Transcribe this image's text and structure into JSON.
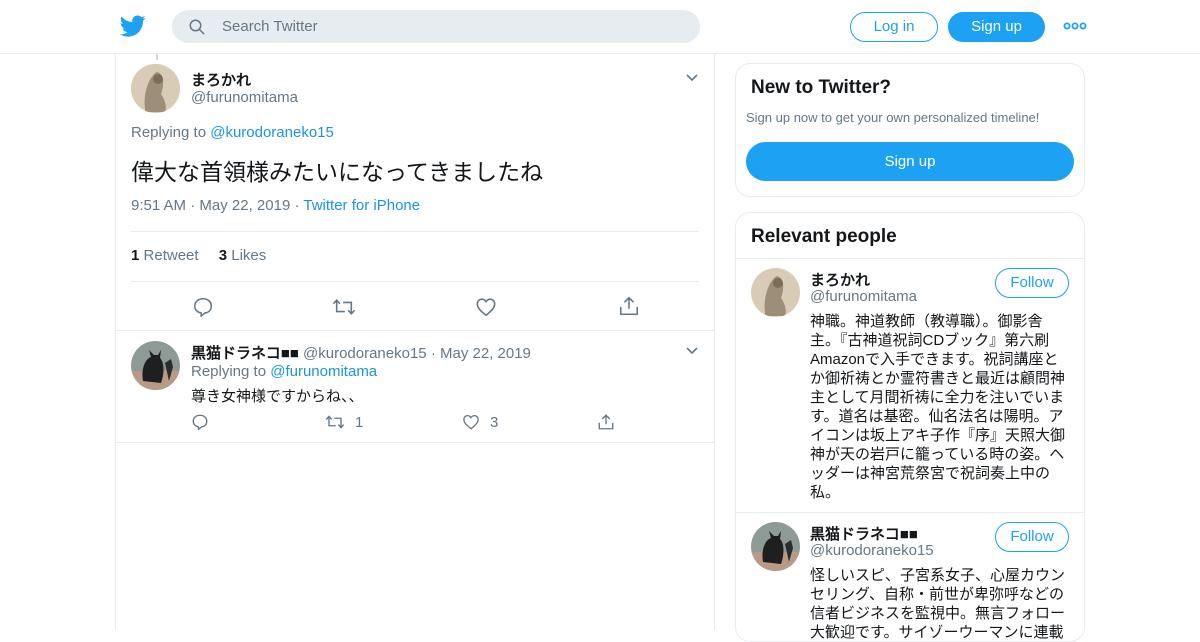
{
  "nav": {
    "search_placeholder": "Search Twitter",
    "login_label": "Log in",
    "signup_label": "Sign up",
    "brand_color": "#1da1f2"
  },
  "main_tweet": {
    "name": "まろかれ",
    "handle": "@furunomitama",
    "replying_prefix": "Replying to ",
    "replying_to": "@kurodoraneko15",
    "text": "偉大な首領様みたいになってきましたね",
    "time": "9:51 AM",
    "date": "May 22, 2019",
    "source": "Twitter for iPhone",
    "retweet_count": "1",
    "retweet_label": "Retweet",
    "like_count": "3",
    "like_label": "Likes",
    "sep": "·"
  },
  "reply_tweet": {
    "name": "黒猫ドラネコ■■",
    "handle": "@kurodoraneko15",
    "date": "May 22, 2019",
    "replying_prefix": "Replying to ",
    "replying_to": "@furunomitama",
    "text": "尊き女神様ですからね、、",
    "retweet_count": "1",
    "like_count": "3",
    "sep": "·"
  },
  "sidebar": {
    "new_title": "New to Twitter?",
    "new_subtitle": "Sign up now to get your own personalized timeline!",
    "signup_label": "Sign up",
    "relevant_title": "Relevant people",
    "people": [
      {
        "name": "まろかれ",
        "handle": "@furunomitama",
        "follow_label": "Follow",
        "bio": "神職。神道教師（教導職）。御影舎主。『古神道祝詞CDブック』第六刷Amazonで入手できます。祝詞講座とか御祈祷とか霊符書きと最近は顧問神主として月間祈祷に全力を注いでいます。道名は基密。仙名法名は陽明。アイコンは坂上アキ子作『序』天照大御神が天の岩戸に籠っている時の姿。ヘッダーは神宮荒祭宮で祝詞奏上中の私。"
      },
      {
        "name": "黒猫ドラネコ■■",
        "handle": "@kurodoraneko15",
        "follow_label": "Follow",
        "bio": "怪しいスピ、子宮系女子、心屋カウンセリング、自称・前世が卑弥呼などの信者ビジネスを監視中。無言フォロー大歓迎です。サイゾーウーマンに連載"
      }
    ]
  }
}
